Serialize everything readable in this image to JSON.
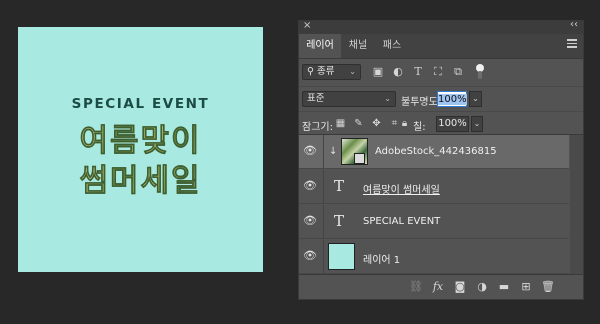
{
  "canvas": {
    "headline": "SPECIAL EVENT",
    "korean_line1": "여름맞이",
    "korean_line2": "썸머세일",
    "background_color": "#a8e9e1"
  },
  "panel": {
    "close_glyph": "×",
    "collapse_glyph": "‹‹",
    "tabs": [
      {
        "label": "레이어",
        "active": true
      },
      {
        "label": "채널",
        "active": false
      },
      {
        "label": "패스",
        "active": false
      }
    ],
    "filter": {
      "kind_label": "종류",
      "icons": [
        "pixel-filter-icon",
        "adjustment-filter-icon",
        "type-filter-icon",
        "shape-filter-icon",
        "smart-object-filter-icon"
      ]
    },
    "blend": {
      "mode": "표준",
      "opacity_label": "불투명도:",
      "opacity_value": "100%"
    },
    "lock": {
      "label": "잠그기:",
      "fill_label": "칠:",
      "fill_value": "100%"
    },
    "layers": [
      {
        "name": "AdobeStock_442436815",
        "type": "smart-object",
        "selected": true,
        "clipped": true
      },
      {
        "name": "여름맞이 썸머세일",
        "type": "text",
        "selected": false
      },
      {
        "name": "SPECIAL EVENT",
        "type": "text",
        "selected": false
      },
      {
        "name": "레이어 1",
        "type": "pixel",
        "selected": false
      }
    ],
    "bottom_icons": [
      "link-layers-icon",
      "fx-icon",
      "add-mask-icon",
      "adjustment-layer-icon",
      "new-group-icon",
      "new-layer-icon",
      "trash-icon"
    ],
    "fx_label": "fx"
  }
}
